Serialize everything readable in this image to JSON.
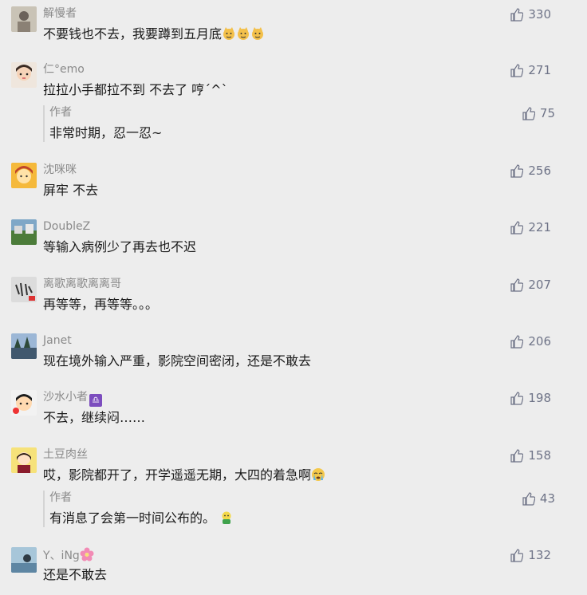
{
  "comments": [
    {
      "nickname": "解慢者",
      "text": "不要钱也不去，我要蹲到五月底",
      "likes": "330",
      "emoji_suffix": "cat-face-emoji x3"
    },
    {
      "nickname": "仁°emo",
      "text": "拉拉小手都拉不到 不去了 哼ˊ^ˋ",
      "likes": "271",
      "reply": {
        "author": "作者",
        "text": "非常时期，忍一忍~",
        "likes": "75"
      }
    },
    {
      "nickname": "沈咪咪",
      "text": "屏牢 不去",
      "likes": "256"
    },
    {
      "nickname": "DoubleZ",
      "text": "等输入病例少了再去也不迟",
      "likes": "221"
    },
    {
      "nickname": "离歌离歌离离哥",
      "text": "再等等，再等等。。。",
      "likes": "207"
    },
    {
      "nickname": "Janet",
      "text": "现在境外输入严重，影院空间密闭，还是不敢去",
      "likes": "206"
    },
    {
      "nickname": "沙水小者",
      "text": "不去，继续闷……",
      "likes": "198",
      "nick_badge": "♎"
    },
    {
      "nickname": "土豆肉丝",
      "text": "哎，影院都开了，开学遥遥无期，大四的着急啊",
      "likes": "158",
      "reply": {
        "author": "作者",
        "text": "有消息了会第一时间公布的。",
        "likes": "43"
      }
    },
    {
      "nickname": "Y、iNg",
      "text": "还是不敢去",
      "likes": "132"
    }
  ]
}
